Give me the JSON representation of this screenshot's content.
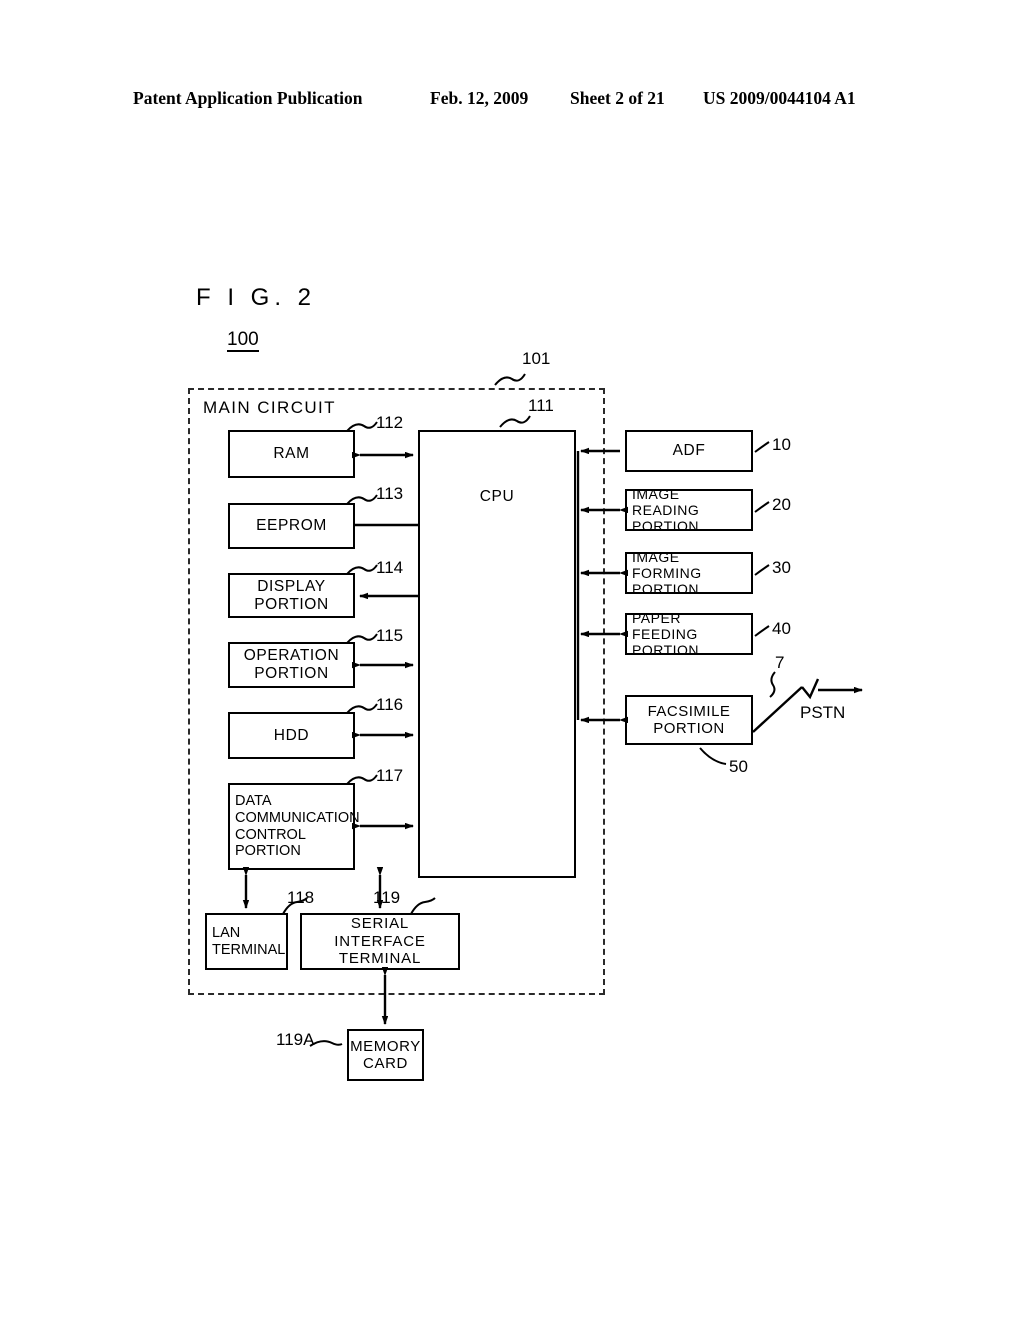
{
  "header": {
    "publication": "Patent Application Publication",
    "date": "Feb. 12, 2009",
    "sheet": "Sheet 2 of 21",
    "patent_number": "US 2009/0044104 A1"
  },
  "figure": {
    "label": "F I G.  2",
    "device_ref": "100",
    "boundary_ref": "101",
    "boundary_title": "MAIN CIRCUIT"
  },
  "blocks": {
    "cpu": {
      "label": "CPU",
      "ref": "111"
    },
    "ram": {
      "label": "RAM",
      "ref": "112"
    },
    "eeprom": {
      "label": "EEPROM",
      "ref": "113"
    },
    "display": {
      "label": "DISPLAY\nPORTION",
      "ref": "114"
    },
    "operation": {
      "label": "OPERATION\nPORTION",
      "ref": "115"
    },
    "hdd": {
      "label": "HDD",
      "ref": "116"
    },
    "data_comm": {
      "label": "DATA\nCOMMUNICATION\nCONTROL\nPORTION",
      "ref": "117"
    },
    "lan": {
      "label": "LAN\nTERMINAL",
      "ref": "118"
    },
    "serial": {
      "label": "SERIAL\nINTERFACE\nTERMINAL",
      "ref": "119"
    },
    "memory_card": {
      "label": "MEMORY\nCARD",
      "ref": "119A"
    },
    "adf": {
      "label": "ADF",
      "ref": "10"
    },
    "image_reading": {
      "label": "IMAGE READING\nPORTION",
      "ref": "20"
    },
    "image_forming": {
      "label": "IMAGE FORMING\nPORTION",
      "ref": "30"
    },
    "paper_feeding": {
      "label": "PAPER FEEDING\nPORTION",
      "ref": "40"
    },
    "facsimile": {
      "label": "FACSIMILE\nPORTION",
      "ref": "50"
    }
  },
  "network": {
    "line_ref": "7",
    "pstn_label": "PSTN"
  }
}
